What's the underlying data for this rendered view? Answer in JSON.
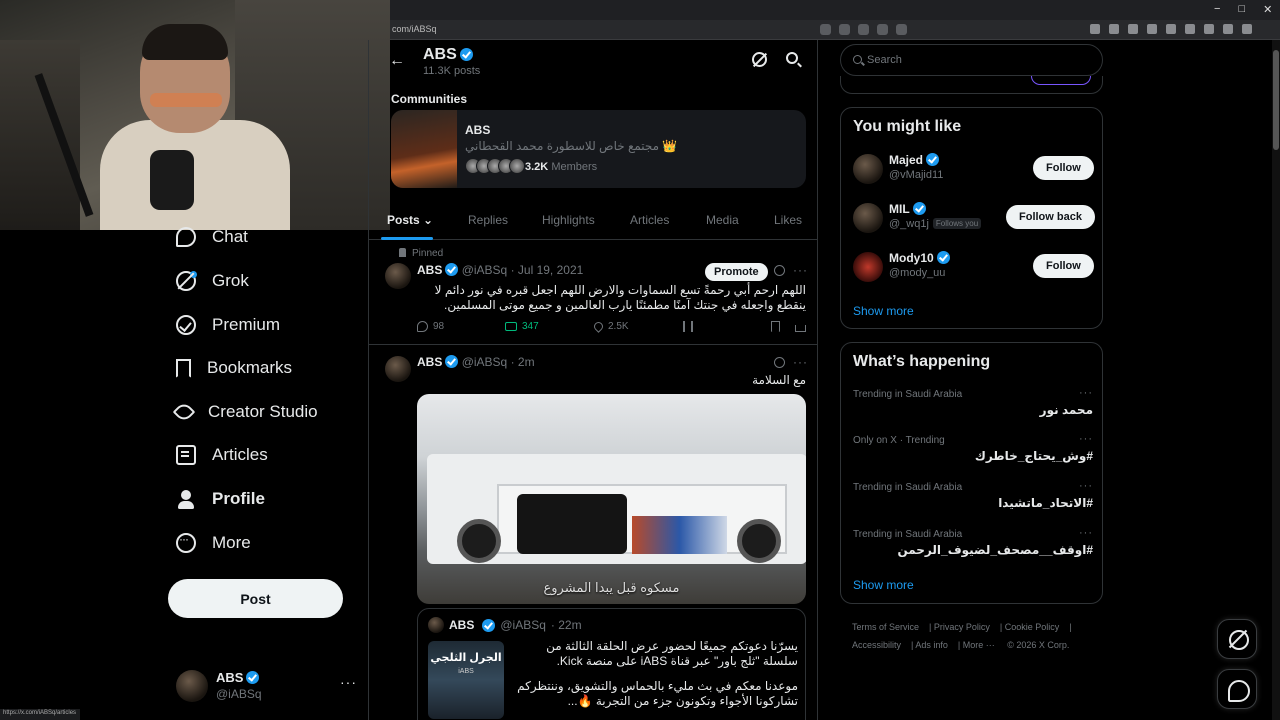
{
  "browser": {
    "url": "com/iABSq",
    "window_controls": [
      "−",
      "□",
      "✕"
    ],
    "status_url": "https://x.com/iABSq/articles"
  },
  "nav": [
    {
      "label": "Chat",
      "icon": "chat-icon"
    },
    {
      "label": "Grok",
      "icon": "grok-icon"
    },
    {
      "label": "Premium",
      "icon": "premium-icon"
    },
    {
      "label": "Bookmarks",
      "icon": "bookmark-icon"
    },
    {
      "label": "Creator Studio",
      "icon": "rocket-icon"
    },
    {
      "label": "Articles",
      "icon": "articles-icon"
    },
    {
      "label": "Profile",
      "icon": "profile-icon"
    },
    {
      "label": "More",
      "icon": "more-icon"
    }
  ],
  "post_button": "Post",
  "account": {
    "name": "ABS",
    "handle": "@iABSq",
    "menu": "···"
  },
  "header": {
    "back": "←",
    "name": "ABS",
    "posts": "11.3K posts"
  },
  "communities": {
    "title": "Communities",
    "name": "ABS",
    "description": "مجتمع خاص للاسطورة محمد القحطاني 👑",
    "count": "3.2K",
    "count_label": "Members"
  },
  "tabs": [
    "Posts",
    "Replies",
    "Highlights",
    "Articles",
    "Media",
    "Likes"
  ],
  "tweets": [
    {
      "pinned": "Pinned",
      "name": "ABS",
      "handle": "@iABSq",
      "date": "· Jul 19, 2021",
      "promote": "Promote",
      "more": "···",
      "text": "اللهم ارحم أبي رحمةً تسع السماوات والارض اللهم اجعل قبره في نور دائم لا ينقطع واجعله في جنتك آمنًا مطمئنًا يارب العالمين و جميع موتى المسلمين.",
      "stats": {
        "replies": "98",
        "reposts": "347",
        "likes": "2.5K"
      }
    },
    {
      "name": "ABS",
      "handle": "@iABSq",
      "date": "· 2m",
      "more": "···",
      "text": "مع السلامة",
      "media_caption": "مسكوه قبل يبدا المشروع",
      "quote": {
        "name": "ABS",
        "handle": "@iABSq",
        "date": "· 22m",
        "image_title": "الجرل الثلجي",
        "image_sub": "iABS",
        "text1": "يسرّنا دعوتكم جميعًا لحضور عرض الحلقة الثالثة من سلسلة \"ثلج باور\" عبر قناة iABS على منصة Kick.",
        "text2": "موعدنا معكم في بث مليء بالحماس والتشويق، وننتظركم تشاركونا الأجواء وتكونون جزء من التجربة 🔥..."
      }
    }
  ],
  "search": {
    "placeholder": "Search"
  },
  "you_might_like": {
    "title": "You might like",
    "items": [
      {
        "name": "Majed",
        "handle": "@vMajid11",
        "follows_you": "",
        "button": "Follow"
      },
      {
        "name": "MIL",
        "handle": "@_wq1j",
        "follows_you": "Follows you",
        "button": "Follow back"
      },
      {
        "name": "Mody10",
        "handle": "@mody_uu",
        "follows_you": "",
        "button": "Follow"
      }
    ],
    "show_more": "Show more"
  },
  "whats_happening": {
    "title": "What’s happening",
    "items": [
      {
        "context": "Trending in Saudi Arabia",
        "name": "محمد نور"
      },
      {
        "context": "Only on X · Trending",
        "name": "#وش_يحتاج_خاطرك"
      },
      {
        "context": "Trending in Saudi Arabia",
        "name": "#الاتحاد_ماتشيدا"
      },
      {
        "context": "Trending in Saudi Arabia",
        "name": "#اوقف__مصحف_لضيوف_الرحمن"
      }
    ],
    "more": "···",
    "show_more": "Show more"
  },
  "footer": [
    "Terms of Service",
    "Privacy Policy",
    "Cookie Policy",
    "Accessibility",
    "Ads info",
    "More ···",
    "© 2026 X Corp."
  ],
  "colors": {
    "accent": "#1d9bf0",
    "repost": "#00ba7c",
    "background": "#000000",
    "text": "#e7e9ea",
    "muted": "#71767b"
  }
}
